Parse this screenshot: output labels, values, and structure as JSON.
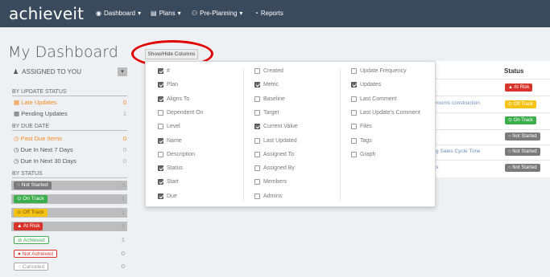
{
  "nav": {
    "logo": "achieveit",
    "items": [
      {
        "label": "Dashboard",
        "icon": "dashboard-icon",
        "caret": "▾"
      },
      {
        "label": "Plans",
        "icon": "plans-icon",
        "caret": "▾"
      },
      {
        "label": "Pre-Planning",
        "icon": "sitemap-icon",
        "caret": "▾"
      },
      {
        "label": "Reports",
        "icon": "reports-icon",
        "caret": ""
      }
    ]
  },
  "page_title": "My Dashboard",
  "sidebar": {
    "assigned": "ASSIGNED TO YOU",
    "update_status_head": "BY UPDATE STATUS",
    "update_status": [
      {
        "label": "Late Updates",
        "count": "0"
      },
      {
        "label": "Pending Updates",
        "count": "1"
      }
    ],
    "due_date_head": "BY DUE DATE",
    "due_date": [
      {
        "label": "Past Due Items",
        "count": "0"
      },
      {
        "label": "Due In Next 7 Days",
        "count": "0"
      },
      {
        "label": "Due In Next 30 Days",
        "count": "0"
      }
    ],
    "status_head": "BY STATUS",
    "statuses": [
      {
        "label": "Not Started",
        "count": "3"
      },
      {
        "label": "On Track",
        "count": "1"
      },
      {
        "label": "Off Track",
        "count": "1"
      },
      {
        "label": "At Risk",
        "count": "1"
      },
      {
        "label": "Achieved",
        "count": "1"
      },
      {
        "label": "Not Achieved",
        "count": "0"
      },
      {
        "label": "Canceled",
        "count": "0"
      }
    ]
  },
  "showhide_label": "Show/Hide Columns",
  "table": {
    "status_header": "Status",
    "rows": [
      {
        "link": "",
        "status": "At Risk"
      },
      {
        "link": "rooms construction",
        "status": "Off Track"
      },
      {
        "link": "",
        "status": "On Track"
      },
      {
        "link": "",
        "status": "Not Started"
      },
      {
        "link": "g Sales Cycle Time",
        "status": "Not Started"
      },
      {
        "link": "s",
        "status": "Not Started"
      }
    ]
  },
  "columns": {
    "col1": [
      {
        "label": "#",
        "checked": true
      },
      {
        "label": "Plan",
        "checked": true
      },
      {
        "label": "Aligns To",
        "checked": true
      },
      {
        "label": "Dependent On",
        "checked": false
      },
      {
        "label": "Level",
        "checked": false
      },
      {
        "label": "Name",
        "checked": true
      },
      {
        "label": "Description",
        "checked": false
      },
      {
        "label": "Status",
        "checked": true
      },
      {
        "label": "Start",
        "checked": true
      },
      {
        "label": "Due",
        "checked": true
      }
    ],
    "col2": [
      {
        "label": "Created",
        "checked": false
      },
      {
        "label": "Metric",
        "checked": true
      },
      {
        "label": "Baseline",
        "checked": false
      },
      {
        "label": "Target",
        "checked": false
      },
      {
        "label": "Current Value",
        "checked": true
      },
      {
        "label": "Last Updated",
        "checked": false
      },
      {
        "label": "Assigned To",
        "checked": false
      },
      {
        "label": "Assigned By",
        "checked": false
      },
      {
        "label": "Members",
        "checked": false
      },
      {
        "label": "Admins",
        "checked": false
      }
    ],
    "col3": [
      {
        "label": "Update Frequency",
        "checked": false
      },
      {
        "label": "Updates",
        "checked": true
      },
      {
        "label": "Last Comment",
        "checked": false
      },
      {
        "label": "Last Update's Comment",
        "checked": false
      },
      {
        "label": "Files",
        "checked": false
      },
      {
        "label": "Tags",
        "checked": false
      },
      {
        "label": "Graph",
        "checked": false
      }
    ]
  },
  "colors": {
    "nav_bg": "#3a4a5d",
    "accent_orange": "#f08a24",
    "not_started": "#7b7b7b",
    "on_track": "#3cae4b",
    "off_track": "#f5c313",
    "at_risk": "#d9342b",
    "highlight_oval": "#e00000"
  }
}
